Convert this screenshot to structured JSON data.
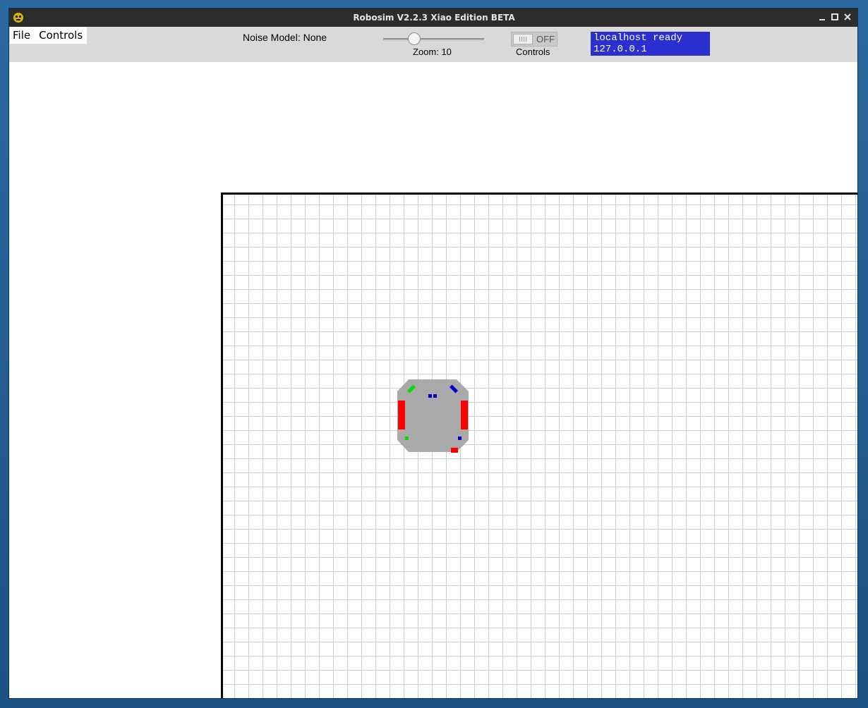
{
  "window": {
    "title": "Robosim V2.2.3 Xiao Edition BETA",
    "controls": [
      "minimize-icon",
      "maximize-icon",
      "close-icon"
    ]
  },
  "menu": {
    "items": [
      "File",
      "Controls"
    ]
  },
  "toolbar": {
    "noise_label": "Noise Model: None",
    "zoom_label": "Zoom: 10",
    "zoom_value": 10,
    "toggle_state": "OFF",
    "controls_label": "Controls"
  },
  "status": {
    "line1": "localhost ready",
    "line2": "127.0.0.1",
    "background": "#2b2fcf"
  },
  "colors": {
    "titlebar": "#2c2c2c",
    "toolbar": "#d9d9d9",
    "grid": "#cfcfcf",
    "robot_body": "#a9a9a9",
    "wheel": "#ff0000",
    "sensor_green": "#00dd00",
    "sensor_blue": "#0000cc"
  }
}
